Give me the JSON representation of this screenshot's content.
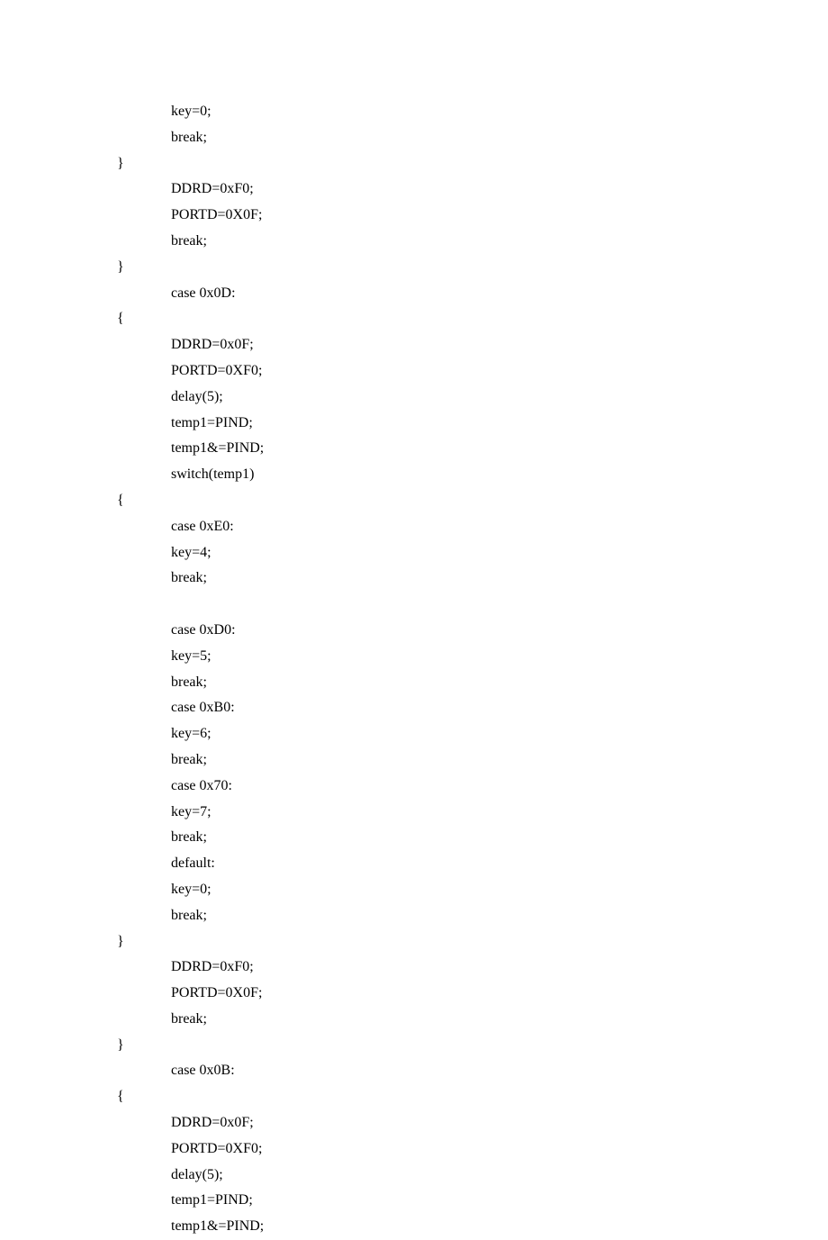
{
  "lines": [
    {
      "indent": 1,
      "text": "key=0;"
    },
    {
      "indent": 1,
      "text": "break;"
    },
    {
      "indent": 0,
      "text": "}"
    },
    {
      "indent": 1,
      "text": "DDRD=0xF0;"
    },
    {
      "indent": 1,
      "text": "PORTD=0X0F;"
    },
    {
      "indent": 1,
      "text": "break;"
    },
    {
      "indent": 0,
      "text": "}"
    },
    {
      "indent": 1,
      "text": "case 0x0D:"
    },
    {
      "indent": 0,
      "text": "{"
    },
    {
      "indent": 1,
      "text": "DDRD=0x0F;"
    },
    {
      "indent": 1,
      "text": "PORTD=0XF0;"
    },
    {
      "indent": 1,
      "text": "delay(5);"
    },
    {
      "indent": 1,
      "text": "temp1=PIND;"
    },
    {
      "indent": 1,
      "text": "temp1&=PIND;"
    },
    {
      "indent": 1,
      "text": "switch(temp1)"
    },
    {
      "indent": 0,
      "text": "{"
    },
    {
      "indent": 1,
      "text": "case 0xE0:"
    },
    {
      "indent": 1,
      "text": "key=4;"
    },
    {
      "indent": 1,
      "text": "break;"
    },
    {
      "indent": 1,
      "text": ""
    },
    {
      "indent": 1,
      "text": "case 0xD0:"
    },
    {
      "indent": 1,
      "text": "key=5;"
    },
    {
      "indent": 1,
      "text": "break;"
    },
    {
      "indent": 1,
      "text": "case 0xB0:"
    },
    {
      "indent": 1,
      "text": "key=6;"
    },
    {
      "indent": 1,
      "text": "break;"
    },
    {
      "indent": 1,
      "text": "case 0x70:"
    },
    {
      "indent": 1,
      "text": "key=7;"
    },
    {
      "indent": 1,
      "text": "break;"
    },
    {
      "indent": 1,
      "text": "default:"
    },
    {
      "indent": 1,
      "text": "key=0;"
    },
    {
      "indent": 1,
      "text": "break;"
    },
    {
      "indent": 0,
      "text": "}"
    },
    {
      "indent": 1,
      "text": "DDRD=0xF0;"
    },
    {
      "indent": 1,
      "text": "PORTD=0X0F;"
    },
    {
      "indent": 1,
      "text": "break;"
    },
    {
      "indent": 0,
      "text": "}"
    },
    {
      "indent": 1,
      "text": "case 0x0B:"
    },
    {
      "indent": 0,
      "text": "{"
    },
    {
      "indent": 1,
      "text": "DDRD=0x0F;"
    },
    {
      "indent": 1,
      "text": "PORTD=0XF0;"
    },
    {
      "indent": 1,
      "text": "delay(5);"
    },
    {
      "indent": 1,
      "text": "temp1=PIND;"
    },
    {
      "indent": 1,
      "text": "temp1&=PIND;"
    }
  ]
}
